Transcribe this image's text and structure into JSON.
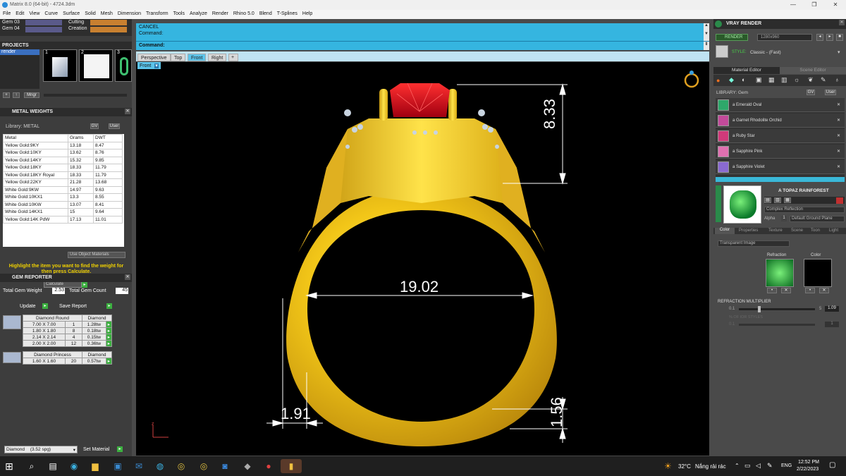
{
  "window": {
    "title": "Matrix 8.0 (64-bit) - 4724.3dm"
  },
  "menu": [
    "File",
    "Edit",
    "View",
    "Curve",
    "Surface",
    "Solid",
    "Mesh",
    "Dimension",
    "Transform",
    "Tools",
    "Analyze",
    "Render",
    "Rhino 5.0",
    "Blend",
    "T-Splines",
    "Help"
  ],
  "toolbar_left": {
    "gem03": "Gem 03",
    "gem04": "Gem 04",
    "cutting": "Cutting",
    "creation": "Creation"
  },
  "projects": {
    "title": "PROJECTS",
    "item": "render",
    "thumbs": [
      "1",
      "2",
      "3"
    ],
    "mngr": "Mngr"
  },
  "metal_weights": {
    "title": "METAL WEIGHTS",
    "library": "Library: METAL",
    "btn_gv": "GV",
    "btn_user": "User",
    "columns": [
      "Metal",
      "Grams",
      "DWT"
    ],
    "rows": [
      [
        "Yellow Gold:9KY",
        "13.18",
        "8.47"
      ],
      [
        "Yellow Gold:10KY",
        "13.62",
        "8.76"
      ],
      [
        "Yellow Gold:14KY",
        "15.32",
        "9.85"
      ],
      [
        "Yellow Gold:18KY",
        "18.33",
        "11.79"
      ],
      [
        "Yellow Gold:18KY Royal",
        "18.33",
        "11.79"
      ],
      [
        "Yellow Gold:22KY",
        "21.28",
        "13.68"
      ],
      [
        "White Gold:9KW",
        "14.97",
        "9.63"
      ],
      [
        "White Gold:10KX1",
        "13.3",
        "8.55"
      ],
      [
        "White Gold:10KW",
        "13.07",
        "8.41"
      ],
      [
        "White Gold:14KX1",
        "15",
        "9.64"
      ],
      [
        "Yellow Gold:14K PdW",
        "17.13",
        "11.01"
      ]
    ],
    "use_object_materials": "Use Object Materials",
    "hint": "Highlight the item you want to find the weight for then press Calculate.",
    "calculate": "Calculate"
  },
  "gem_reporter": {
    "title": "GEM REPORTER",
    "total_gem_weight_label": "Total Gem Weight",
    "total_gem_weight": "2.53",
    "total_gem_count_label": "Total Gem Count",
    "total_gem_count": "45",
    "update": "Update",
    "save_report": "Save Report",
    "groups": [
      {
        "shape": "Diamond Round",
        "material": "Diamond",
        "rows": [
          [
            "7.00 X 7.00",
            "1",
            "1.28tw"
          ],
          [
            "1.80 X 1.80",
            "8",
            "0.18tw"
          ],
          [
            "2.14 X 2.14",
            "4",
            "0.15tw"
          ],
          [
            "2.00 X 2.00",
            "12",
            "0.36tw"
          ]
        ]
      },
      {
        "shape": "Diamond Princess",
        "material": "Diamond",
        "rows": [
          [
            "1.60 X 1.60",
            "20",
            "0.57tw"
          ]
        ]
      }
    ],
    "material_select": "Diamond",
    "material_sg": "(3.52 spg)",
    "set_material": "Set Material"
  },
  "command": {
    "line1": "CANCEL",
    "line2": "Command:",
    "prompt": "Command:"
  },
  "viewport_tabs": [
    "Perspective",
    "Top",
    "Front",
    "Right"
  ],
  "active_tab": "Front",
  "viewport_label": "Front",
  "dimensions": {
    "inner_diameter": "19.02",
    "head_height": "8.33",
    "shank_width": "1.91",
    "shank_thickness": "1.56"
  },
  "axis_label": "z",
  "vray": {
    "title": "VRAY RENDER",
    "render": "RENDER",
    "resolution": "1280x960",
    "style_label": "STYLE:",
    "style_value": "Classic - (Fast)",
    "tabs": [
      "Material Editor",
      "Scene Editor"
    ],
    "library": "LIBRARY: Gem",
    "btn_gv": "GV",
    "btn_user": "User",
    "materials": [
      {
        "name": "a Emerald Oval",
        "color": "#2ea86a"
      },
      {
        "name": "a Garnet Rhodolite Orchid",
        "color": "#c24a9a"
      },
      {
        "name": "a Ruby Star",
        "color": "#d03a7a"
      },
      {
        "name": "a Sapphire Pink",
        "color": "#e070b0"
      },
      {
        "name": "a Sapphire Violet",
        "color": "#8a6ad0"
      }
    ],
    "selected_material": "A TOPAZ RAINFOREST",
    "selected_color": "#1c9a3c",
    "complex_reflection": "Complex Reflection",
    "alpha": "Alpha",
    "alpha_value": "1",
    "ground_plane": "Default Ground Plane",
    "sub_tabs": [
      "Color",
      "Properties",
      "Texture",
      "Scene",
      "Toon",
      "Light"
    ],
    "transparent_image": "Transparent Image",
    "refraction": "Refraction",
    "color": "Color",
    "refraction_multiplier_label": "REFRACTION MULTIPLIER",
    "rm_min": "0.1",
    "rm_max": "5",
    "rm_value": "1.09",
    "ior_label": "% OF IOR STYLES",
    "ior_min": "0.1",
    "ior_value": "1",
    "slider_fraction": 0.26
  },
  "taskbar": {
    "weather": "32°C",
    "weather_text": "Nắng rải rác",
    "lang": "ENG",
    "time": "12:52 PM",
    "date": "2/22/2023",
    "apps": [
      "search",
      "taskview",
      "edge",
      "explorer",
      "store",
      "mail",
      "app1",
      "chrome",
      "chrome2",
      "zalo",
      "app2",
      "app3",
      "matrix"
    ]
  }
}
